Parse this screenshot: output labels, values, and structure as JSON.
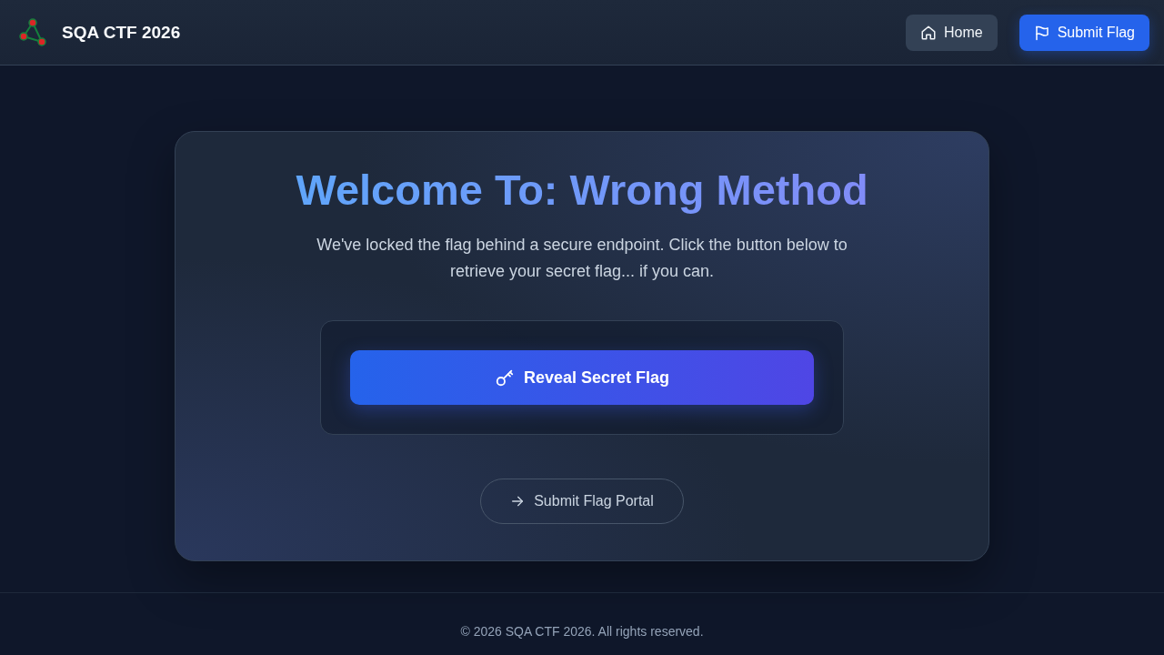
{
  "header": {
    "brand": "SQA CTF 2026",
    "nav": [
      {
        "label": "Home",
        "kind": "secondary"
      },
      {
        "label": "Submit Flag",
        "kind": "primary"
      }
    ]
  },
  "card": {
    "title": "Welcome To: Wrong Method",
    "description": "We've locked the flag behind a secure endpoint. Click the button below to retrieve your secret flag... if you can.",
    "action_button": "Reveal Secret Flag",
    "portal_link": "Submit Flag Portal"
  },
  "footer": {
    "copyright": "© 2026 SQA CTF 2026. All rights reserved."
  }
}
